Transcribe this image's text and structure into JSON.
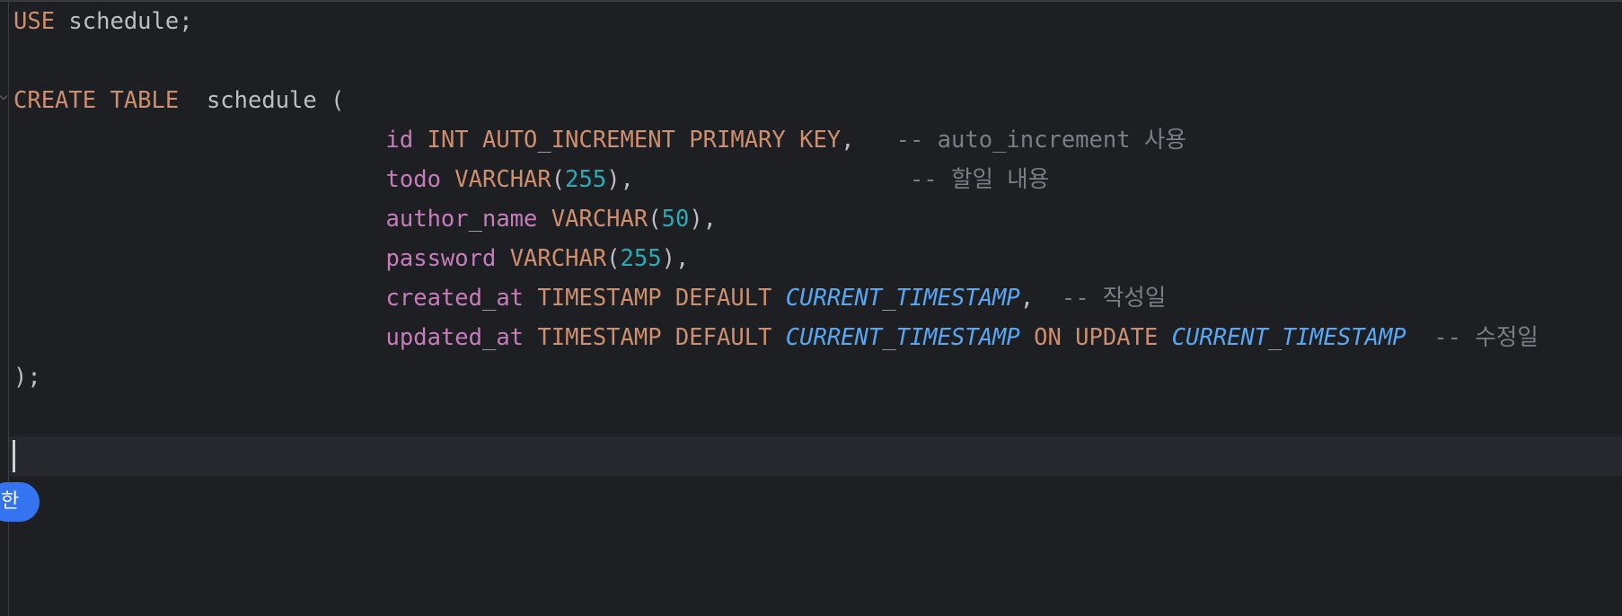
{
  "code": {
    "line1": {
      "kw_use": "USE",
      "rest": " schedule;"
    },
    "line3": {
      "kw_create_table": "CREATE TABLE",
      "rest": "  schedule ("
    },
    "line4": {
      "indent": "                           ",
      "field": "id",
      "sp1": " ",
      "type": "INT AUTO_INCREMENT PRIMARY KEY",
      "punct": ",",
      "sp2": "   ",
      "comment": "-- auto_increment 사용"
    },
    "line5": {
      "indent": "                           ",
      "field": "todo",
      "sp1": " ",
      "type": "VARCHAR",
      "paren_open": "(",
      "number": "255",
      "paren_close": "),",
      "sp2": "                    ",
      "comment": "-- 할일 내용"
    },
    "line6": {
      "indent": "                           ",
      "field": "author_name",
      "sp1": " ",
      "type": "VARCHAR",
      "paren_open": "(",
      "number": "50",
      "paren_close": "),"
    },
    "line7": {
      "indent": "                           ",
      "field": "password",
      "sp1": " ",
      "type": "VARCHAR",
      "paren_open": "(",
      "number": "255",
      "paren_close": "),"
    },
    "line8": {
      "indent": "                           ",
      "field": "created_at",
      "sp1": " ",
      "type": "TIMESTAMP DEFAULT",
      "sp2": " ",
      "func": "CURRENT_TIMESTAMP",
      "punct": ",",
      "sp3": "  ",
      "comment": "-- 작성일"
    },
    "line9": {
      "indent": "                           ",
      "field": "updated_at",
      "sp1": " ",
      "type": "TIMESTAMP DEFAULT",
      "sp2": " ",
      "func1": "CURRENT_TIMESTAMP",
      "sp3": " ",
      "kw_on_update": "ON UPDATE",
      "sp4": " ",
      "func2": "CURRENT_TIMESTAMP",
      "sp5": "  ",
      "comment": "-- 수정일"
    },
    "line10": {
      "close": ");"
    }
  },
  "ime": {
    "label": "한"
  },
  "colors": {
    "background": "#1e1f22",
    "keyword": "#cf8e6d",
    "field": "#c77dbb",
    "number": "#2aacb8",
    "function": "#56a8f5",
    "comment": "#7a7e85",
    "ime_badge": "#3574f0"
  }
}
